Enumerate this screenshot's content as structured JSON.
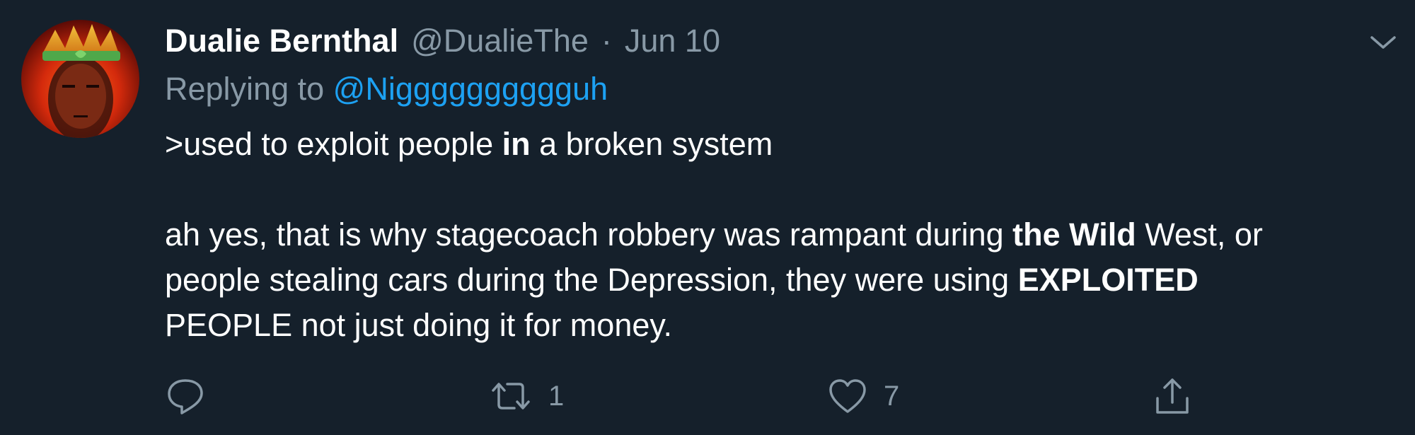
{
  "tweet": {
    "author": {
      "display_name": "Dualie Bernthal",
      "handle": "@DualieThe"
    },
    "separator": "·",
    "date": "Jun 10",
    "replying_prefix": "Replying to ",
    "replying_to": "@Nigggggggggguh",
    "body": {
      "line1_a": ">used to exploit people ",
      "line1_bold": "in",
      "line1_b": " a broken system",
      "para2_a": "ah yes, that is why stagecoach robbery was rampant during ",
      "para2_bold1": "the Wild",
      "para2_b": " West, or people stealing cars during the Depression, they were using ",
      "para2_bold2": "EXPLOITED",
      "para2_c": " PEOPLE not just doing it for money."
    },
    "actions": {
      "reply_icon": "comment-icon",
      "retweet_icon": "retweet-icon",
      "retweet_count": "1",
      "like_icon": "heart-icon",
      "like_count": "7",
      "share_icon": "share-icon"
    }
  },
  "colors": {
    "background": "#15202b",
    "primary_text": "#ffffff",
    "secondary_text": "#8899a6",
    "link": "#1da1f2"
  }
}
